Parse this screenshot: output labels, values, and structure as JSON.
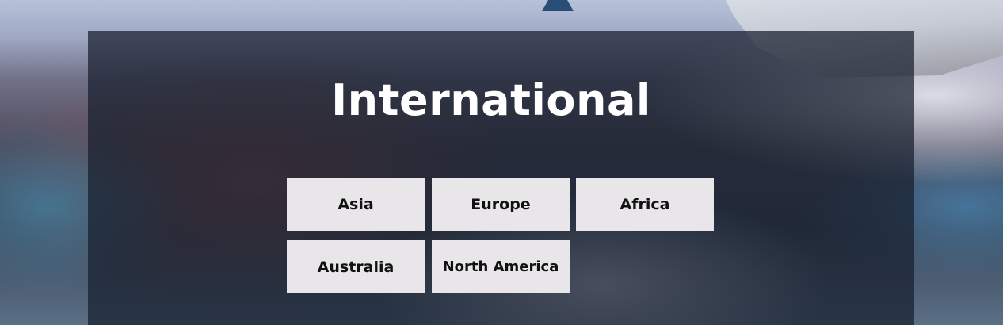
{
  "section": {
    "title": "International"
  },
  "regions": [
    {
      "label": "Asia"
    },
    {
      "label": "Europe"
    },
    {
      "label": "Africa"
    },
    {
      "label": "Australia"
    },
    {
      "label": "North America"
    }
  ]
}
